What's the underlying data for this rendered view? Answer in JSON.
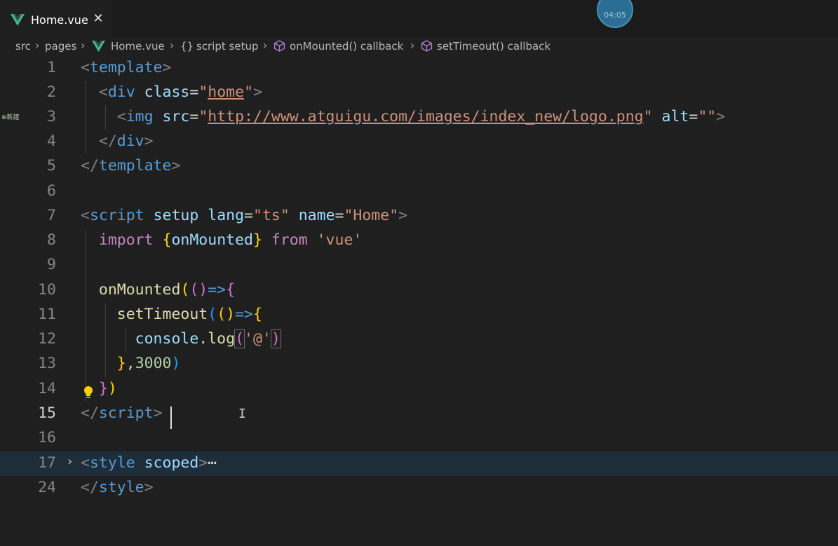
{
  "tab": {
    "title": "Home.vue",
    "close_glyph": "✕",
    "icon": "vue-logo-icon"
  },
  "timer": {
    "label": "04:05"
  },
  "breadcrumb": {
    "items": [
      "src",
      "pages",
      "Home.vue",
      "script setup",
      "onMounted() callback",
      "setTimeout() callback"
    ],
    "braces": "{}"
  },
  "editor": {
    "line_numbers": [
      "1",
      "2",
      "3",
      "4",
      "5",
      "6",
      "7",
      "8",
      "9",
      "10",
      "11",
      "12",
      "13",
      "14",
      "15",
      "16",
      "17",
      "24"
    ],
    "active_line": "15",
    "fold_ellipsis": "⋯",
    "gutter_hint": "⊕新建",
    "colors": {
      "keyword": "#c586c0",
      "string": "#ce9178",
      "tag": "#569cd6",
      "attribute": "#9cdcfe"
    }
  }
}
